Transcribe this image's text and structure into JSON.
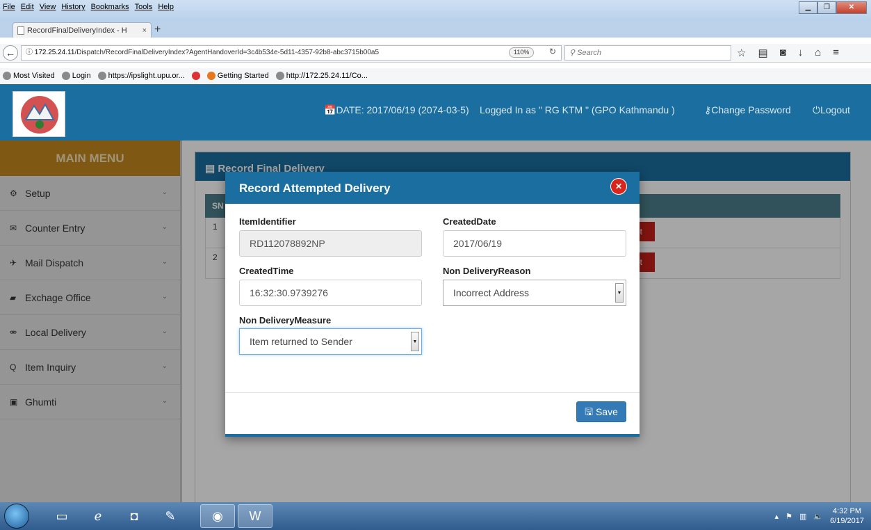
{
  "browser": {
    "menus": [
      "File",
      "Edit",
      "View",
      "History",
      "Bookmarks",
      "Tools",
      "Help"
    ],
    "tab_title": "RecordFinalDeliveryIndex - H",
    "tab_close": "×",
    "new_tab": "+",
    "url_host": "172.25.24.11",
    "url_path": "/Dispatch/RecordFinalDeliveryIndex?AgentHandoverId=3c4b534e-5d11-4357-92b8-abc3715b00a5",
    "zoom": "110%",
    "search_placeholder": "Search",
    "bookmarks": [
      "Most Visited",
      "Login",
      "https://ipslight.upu.or...",
      "Getting Started",
      "http://172.25.24.11/Co..."
    ]
  },
  "header": {
    "date": "DATE: 2017/06/19 (2074-03-5)",
    "logged_in": "Logged In as \" RG KTM \" (GPO Kathmandu )",
    "change_password": "Change Password",
    "logout": "Logout"
  },
  "sidebar": {
    "title": "MAIN MENU",
    "items": [
      {
        "label": "Setup",
        "icon": "cogs-icon"
      },
      {
        "label": "Counter Entry",
        "icon": "envelope-icon"
      },
      {
        "label": "Mail Dispatch",
        "icon": "plane-icon"
      },
      {
        "label": "Exchage Office",
        "icon": "briefcase-icon"
      },
      {
        "label": "Local Delivery",
        "icon": "bicycle-icon"
      },
      {
        "label": "Item Inquiry",
        "icon": "search-icon"
      },
      {
        "label": "Ghumti",
        "icon": "bus-icon"
      }
    ]
  },
  "panel": {
    "title": "Record Final Delivery",
    "col_sn": "SN",
    "rows": [
      {
        "sn": "1",
        "action": "pt"
      },
      {
        "sn": "2",
        "action": "pt"
      }
    ]
  },
  "modal": {
    "title": "Record Attempted Delivery",
    "item_identifier_label": "ItemIdentifier",
    "item_identifier": "RD112078892NP",
    "created_date_label": "CreatedDate",
    "created_date": "2017/06/19",
    "created_time_label": "CreatedTime",
    "created_time": "16:32:30.9739276",
    "reason_label": "Non DeliveryReason",
    "reason": "Incorrect Address",
    "measure_label": "Non DeliveryMeasure",
    "measure": "Item returned to Sender",
    "save": "Save"
  },
  "taskbar": {
    "time": "4:32 PM",
    "date": "6/19/2017"
  },
  "colors": {
    "brand_blue": "#1b6fa0",
    "menu_gold": "#c38820",
    "danger_red": "#c51f1a",
    "primary_button": "#337ab7"
  }
}
